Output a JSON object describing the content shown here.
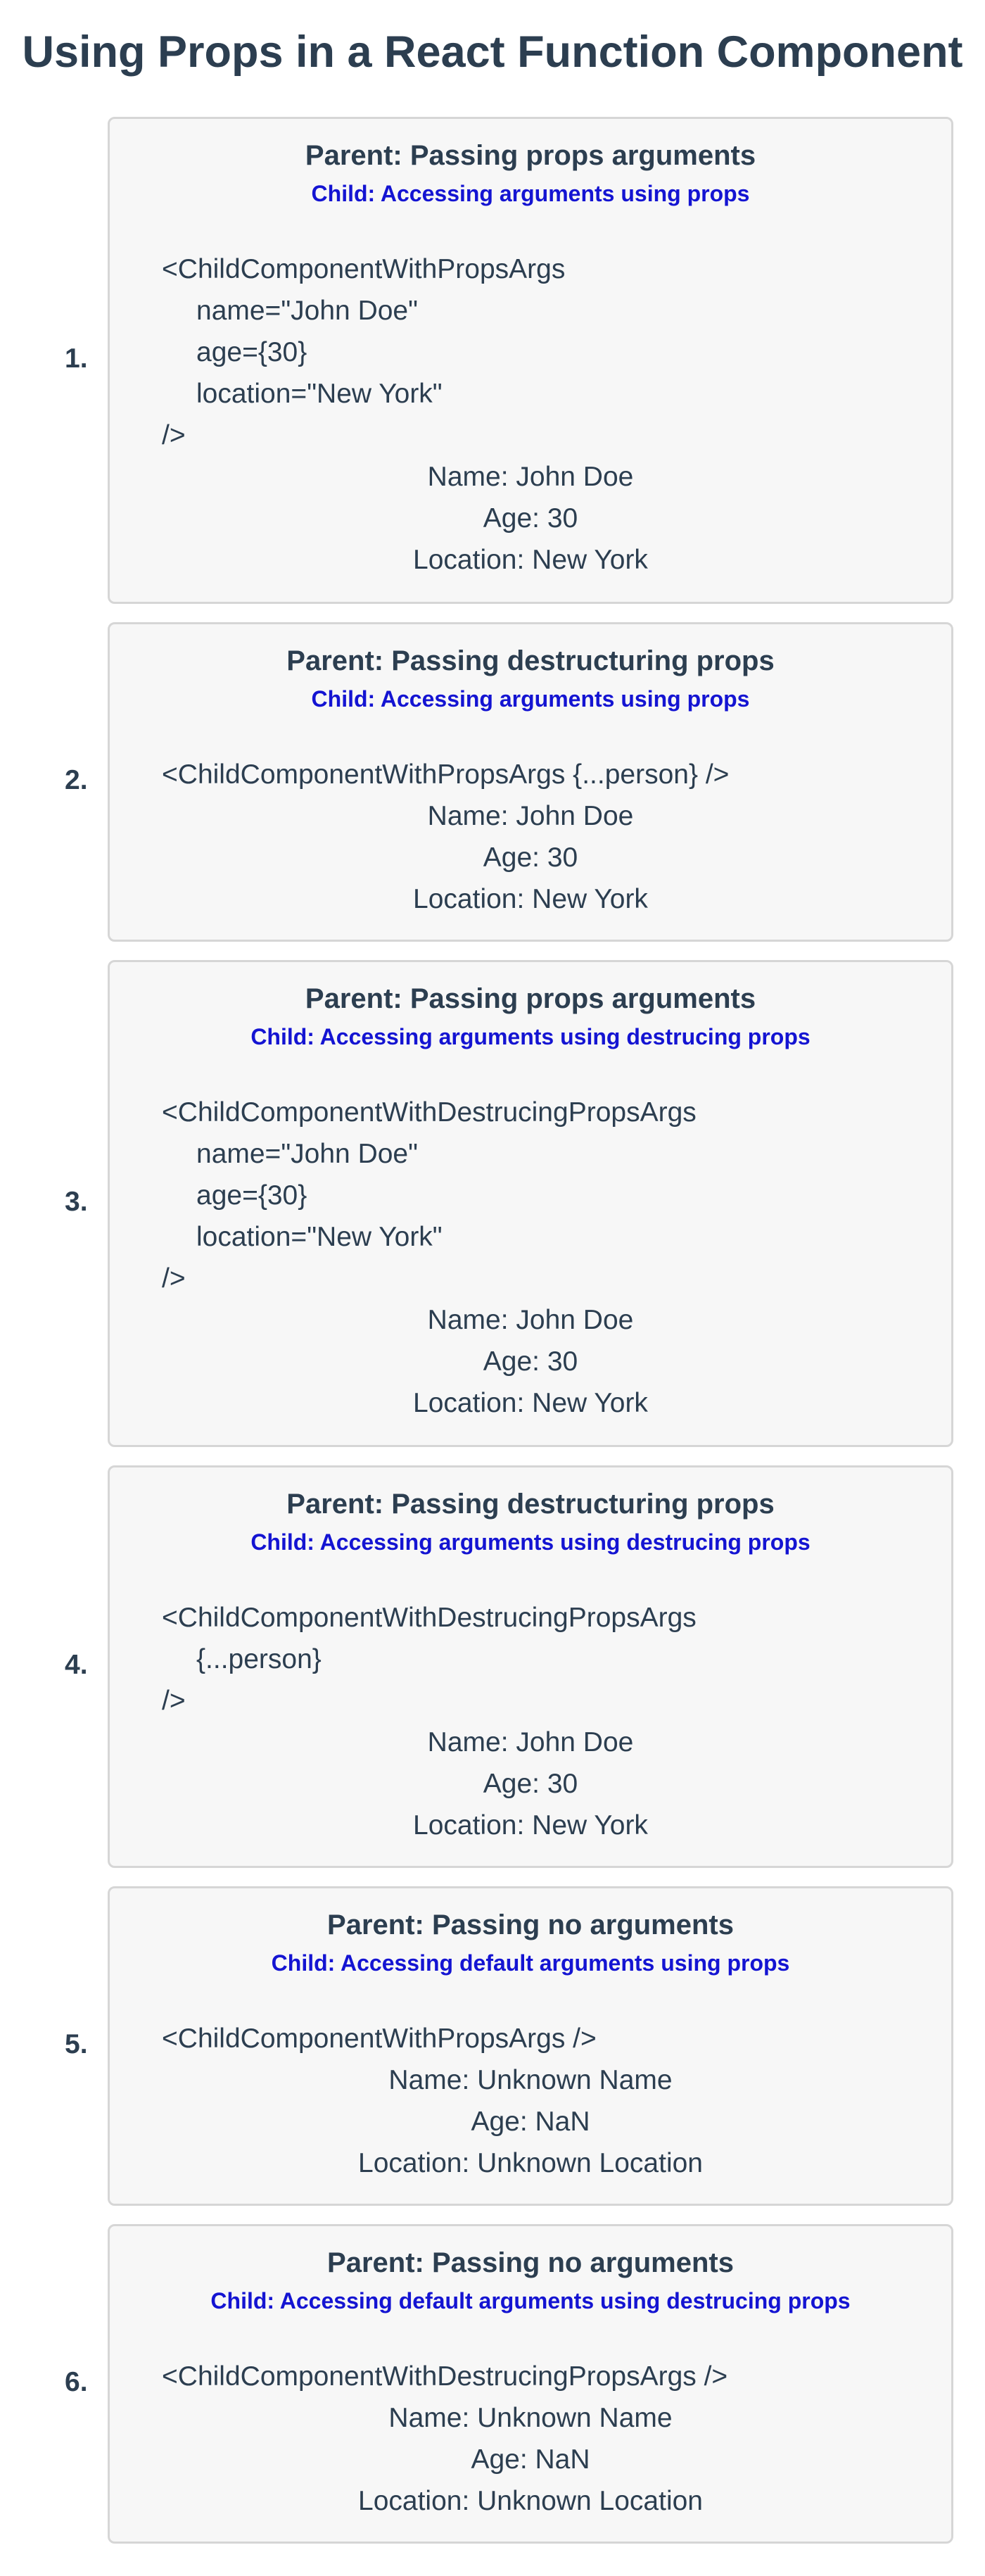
{
  "page_title": "Using Props in a React Function Component",
  "examples": [
    {
      "number": "1.",
      "parent": "Parent: Passing props arguments",
      "child": "Child: Accessing arguments using props",
      "code": [
        "<ChildComponentWithPropsArgs",
        "name=\"John Doe\"",
        "age={30}",
        "location=\"New York\"",
        "/>"
      ],
      "output": [
        "Name: John Doe",
        "Age: 30",
        "Location: New York"
      ]
    },
    {
      "number": "2.",
      "parent": "Parent: Passing destructuring props",
      "child": "Child: Accessing arguments using props",
      "code": [
        "<ChildComponentWithPropsArgs {...person} />"
      ],
      "output": [
        "Name: John Doe",
        "Age: 30",
        "Location: New York"
      ]
    },
    {
      "number": "3.",
      "parent": "Parent: Passing props arguments",
      "child": "Child: Accessing arguments using destrucing props",
      "code": [
        "<ChildComponentWithDestrucingPropsArgs",
        "name=\"John Doe\"",
        "age={30}",
        "location=\"New York\"",
        "/>"
      ],
      "output": [
        "Name: John Doe",
        "Age: 30",
        "Location: New York"
      ]
    },
    {
      "number": "4.",
      "parent": "Parent: Passing destructuring props",
      "child": "Child: Accessing arguments using destrucing props",
      "code": [
        "<ChildComponentWithDestrucingPropsArgs",
        "{...person}",
        "/>"
      ],
      "output": [
        "Name: John Doe",
        "Age: 30",
        "Location: New York"
      ]
    },
    {
      "number": "5.",
      "parent": "Parent: Passing no arguments",
      "child": "Child: Accessing default arguments using props",
      "code": [
        "<ChildComponentWithPropsArgs />"
      ],
      "output": [
        "Name: Unknown Name",
        "Age: NaN",
        "Location: Unknown Location"
      ]
    },
    {
      "number": "6.",
      "parent": "Parent: Passing no arguments",
      "child": "Child: Accessing default arguments using destrucing props",
      "code": [
        "<ChildComponentWithDestrucingPropsArgs />"
      ],
      "output": [
        "Name: Unknown Name",
        "Age: NaN",
        "Location: Unknown Location"
      ]
    }
  ]
}
